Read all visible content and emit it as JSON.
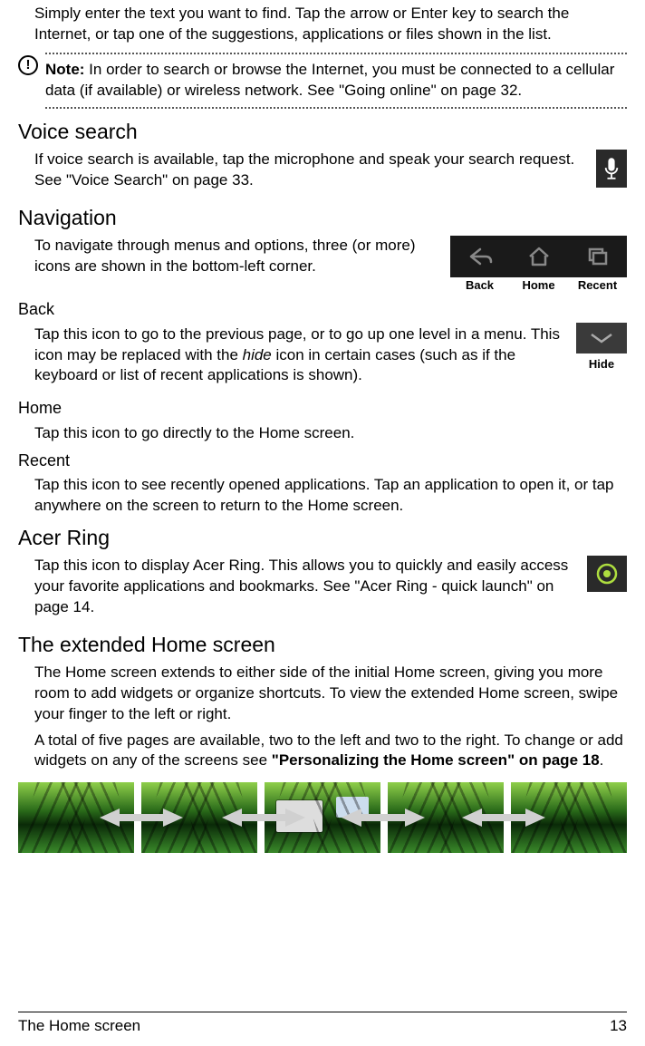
{
  "intro": "Simply enter the text you want to find. Tap the arrow or Enter key to search the Internet, or tap one of the suggestions, applications or files shown in the list.",
  "note": {
    "label": "Note:",
    "text": " In order to search or browse the Internet, you must be connected to a cellular data (if available) or wireless network. See \"Going online\" on page 32."
  },
  "voice": {
    "heading": "Voice search",
    "text": "If voice search is available, tap the microphone and speak your search request. See \"Voice Search\" on page 33."
  },
  "navigation": {
    "heading": "Navigation",
    "intro": "To navigate through menus and options, three (or more) icons are shown in the bottom-left corner.",
    "labels": {
      "back": "Back",
      "home": "Home",
      "recent": "Recent",
      "hide": "Hide"
    },
    "back": {
      "heading": "Back",
      "text_pre": "Tap this icon to go to the previous page, or to go up one level in a menu. This icon may be replaced with the ",
      "italic": "hide",
      "text_post": " icon in certain cases (such as if the keyboard or list of recent applications is shown)."
    },
    "home": {
      "heading": "Home",
      "text": "Tap this icon to go directly to the Home screen."
    },
    "recent": {
      "heading": "Recent",
      "text": "Tap this icon to see recently opened applications. Tap an application to open it, or tap anywhere on the screen to return to the Home screen."
    }
  },
  "ring": {
    "heading": "Acer Ring",
    "text": "Tap this icon to display Acer Ring. This allows you to quickly and easily access your favorite applications and bookmarks. See \"Acer Ring - quick launch\" on page 14."
  },
  "extended": {
    "heading": "The extended Home screen",
    "p1": "The Home screen extends to either side of the initial Home screen, giving you more room to add widgets or organize shortcuts. To view the extended Home screen, swipe your finger to the left or right.",
    "p2_pre": "A total of five pages are available, two to the left and two to the right. To change or add widgets on any of the screens see ",
    "p2_bold": "\"Personalizing the Home screen\" on page 18",
    "p2_post": "."
  },
  "footer": {
    "title": "The Home screen",
    "page": "13"
  }
}
